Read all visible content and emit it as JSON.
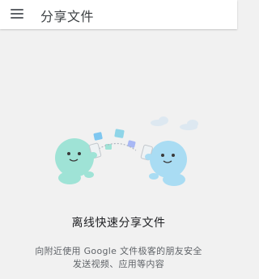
{
  "toolbar": {
    "title": "分享文件",
    "menu_icon": "hamburger-menu-icon"
  },
  "content": {
    "heading": "离线快速分享文件",
    "description_line1": "向附近使用 Google 文件极客的朋友安全",
    "description_line2": "发送视频、应用等内容"
  },
  "colors": {
    "toolbar_bg": "#ffffff",
    "page_bg": "#f1f1f1",
    "character_green": "#9fe3d6",
    "character_blue": "#a9dcf3",
    "cloud": "#dbe7f0"
  }
}
